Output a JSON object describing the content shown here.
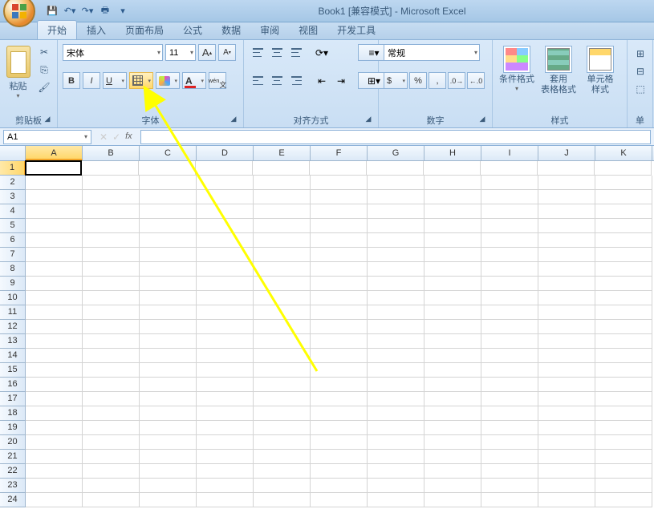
{
  "title": "Book1  [兼容模式] - Microsoft Excel",
  "tabs": [
    "开始",
    "插入",
    "页面布局",
    "公式",
    "数据",
    "审阅",
    "视图",
    "开发工具"
  ],
  "active_tab_index": 0,
  "groups": {
    "clipboard": {
      "label": "剪贴板",
      "paste": "粘贴"
    },
    "font": {
      "label": "字体",
      "name": "宋体",
      "size": "11"
    },
    "alignment": {
      "label": "对齐方式"
    },
    "number": {
      "label": "数字",
      "format": "常规"
    },
    "styles": {
      "label": "样式",
      "cond": "条件格式",
      "table": "套用\n表格格式",
      "cell": "单元格\n样式"
    },
    "cells": {
      "label": "单"
    }
  },
  "name_box": "A1",
  "columns": [
    "A",
    "B",
    "C",
    "D",
    "E",
    "F",
    "G",
    "H",
    "I",
    "J",
    "K"
  ],
  "row_count": 24,
  "active_cell": {
    "row": 1,
    "col": "A"
  }
}
